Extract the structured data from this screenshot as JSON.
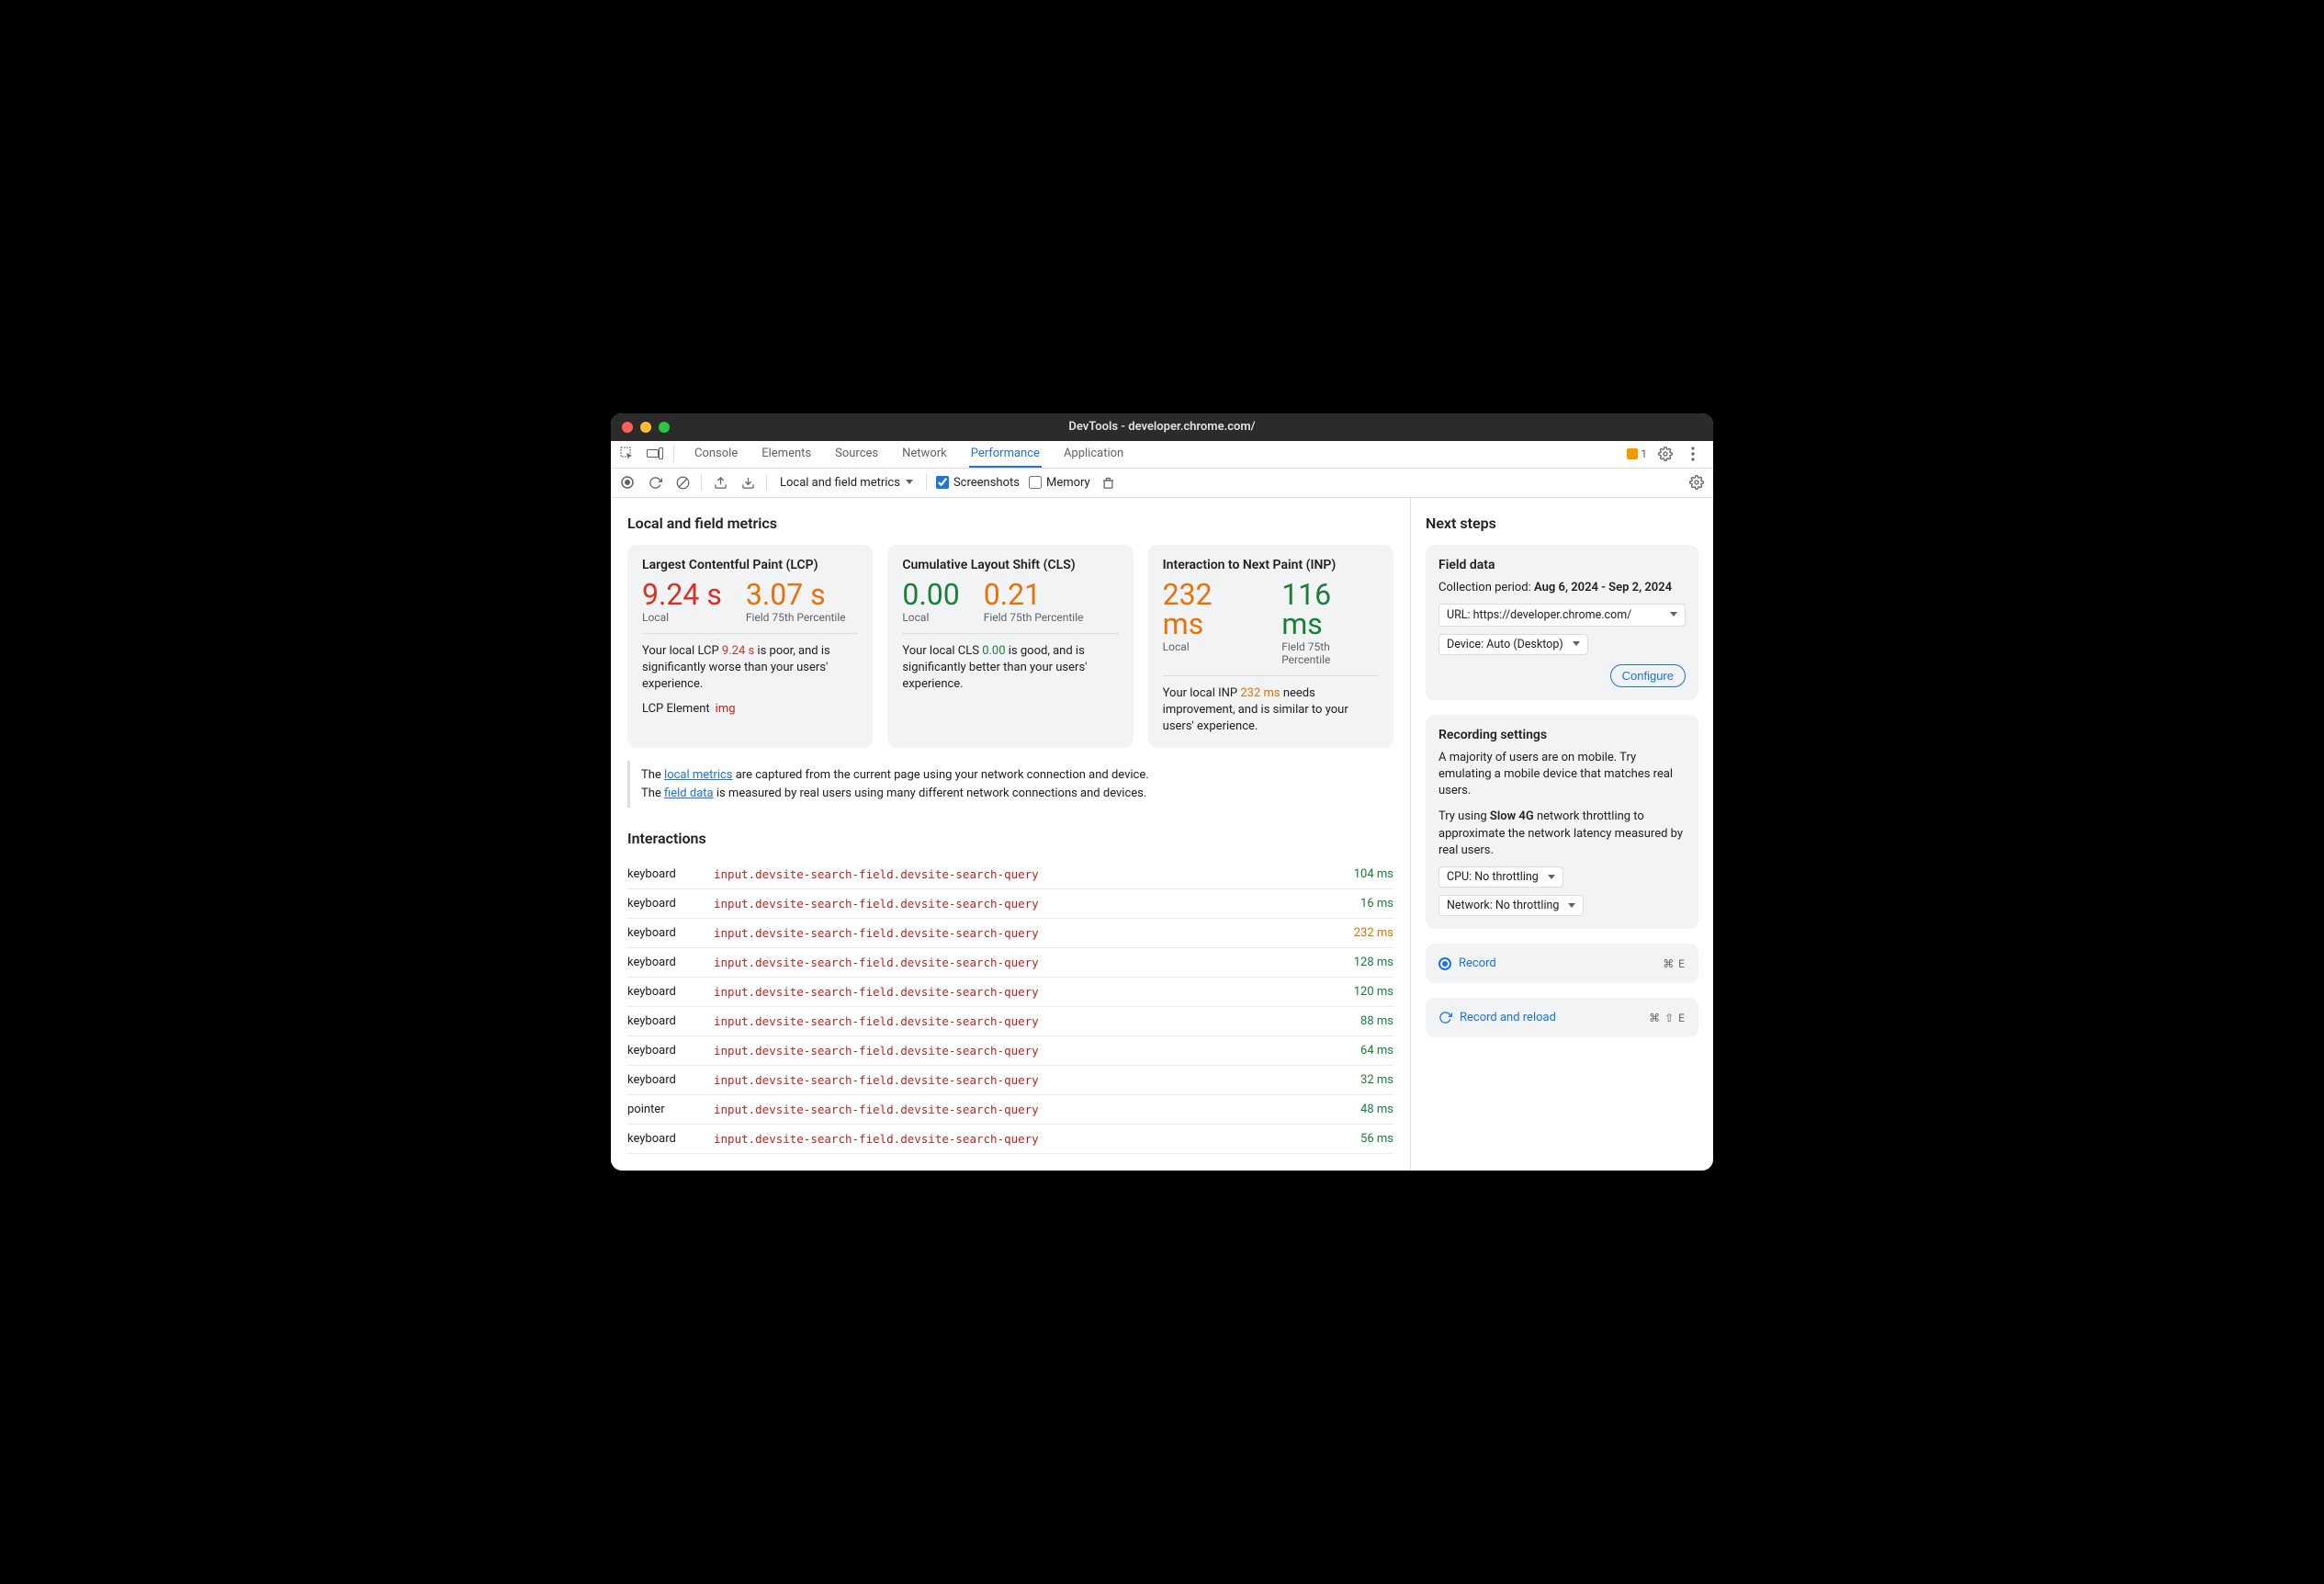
{
  "window": {
    "title": "DevTools - developer.chrome.com/"
  },
  "tabs": {
    "items": [
      "Console",
      "Elements",
      "Sources",
      "Network",
      "Performance",
      "Application"
    ],
    "active_index": 4
  },
  "issue_count": "1",
  "toolbar": {
    "mode_selector": "Local and field metrics",
    "screenshots_label": "Screenshots",
    "screenshots_checked": true,
    "memory_label": "Memory",
    "memory_checked": false
  },
  "left_heading": "Local and field metrics",
  "metrics": [
    {
      "title": "Largest Contentful Paint (LCP)",
      "local_value": "9.24 s",
      "local_class": "poor",
      "field_value": "3.07 s",
      "field_class": "warn",
      "local_label": "Local",
      "field_label": "Field 75th Percentile",
      "desc_pre": "Your local LCP ",
      "desc_val": "9.24 s",
      "desc_val_class": "poor",
      "desc_post": " is poor, and is significantly worse than your users' experience.",
      "extra_label": "LCP Element",
      "extra_tag": "img"
    },
    {
      "title": "Cumulative Layout Shift (CLS)",
      "local_value": "0.00",
      "local_class": "good",
      "field_value": "0.21",
      "field_class": "warn",
      "local_label": "Local",
      "field_label": "Field 75th Percentile",
      "desc_pre": "Your local CLS ",
      "desc_val": "0.00",
      "desc_val_class": "good",
      "desc_post": " is good, and is significantly better than your users' experience."
    },
    {
      "title": "Interaction to Next Paint (INP)",
      "local_value": "232 ms",
      "local_class": "warn",
      "field_value": "116 ms",
      "field_class": "good",
      "local_label": "Local",
      "field_label": "Field 75th Percentile",
      "desc_pre": "Your local INP ",
      "desc_val": "232 ms",
      "desc_val_class": "warn",
      "desc_post": " needs improvement, and is similar to your users' experience."
    }
  ],
  "info_box": {
    "line1_pre": "The ",
    "line1_link": "local metrics",
    "line1_post": " are captured from the current page using your network connection and device.",
    "line2_pre": "The ",
    "line2_link": "field data",
    "line2_post": " is measured by real users using many different network connections and devices."
  },
  "interactions_heading": "Interactions",
  "interactions": [
    {
      "type": "keyboard",
      "target": "input.devsite-search-field.devsite-search-query",
      "time": "104 ms",
      "cls": ""
    },
    {
      "type": "keyboard",
      "target": "input.devsite-search-field.devsite-search-query",
      "time": "16 ms",
      "cls": ""
    },
    {
      "type": "keyboard",
      "target": "input.devsite-search-field.devsite-search-query",
      "time": "232 ms",
      "cls": "warn"
    },
    {
      "type": "keyboard",
      "target": "input.devsite-search-field.devsite-search-query",
      "time": "128 ms",
      "cls": ""
    },
    {
      "type": "keyboard",
      "target": "input.devsite-search-field.devsite-search-query",
      "time": "120 ms",
      "cls": ""
    },
    {
      "type": "keyboard",
      "target": "input.devsite-search-field.devsite-search-query",
      "time": "88 ms",
      "cls": ""
    },
    {
      "type": "keyboard",
      "target": "input.devsite-search-field.devsite-search-query",
      "time": "64 ms",
      "cls": ""
    },
    {
      "type": "keyboard",
      "target": "input.devsite-search-field.devsite-search-query",
      "time": "32 ms",
      "cls": ""
    },
    {
      "type": "pointer",
      "target": "input.devsite-search-field.devsite-search-query",
      "time": "48 ms",
      "cls": ""
    },
    {
      "type": "keyboard",
      "target": "input.devsite-search-field.devsite-search-query",
      "time": "56 ms",
      "cls": ""
    }
  ],
  "next_steps_heading": "Next steps",
  "field_data": {
    "title": "Field data",
    "period_label": "Collection period:",
    "period_value": "Aug 6, 2024 - Sep 2, 2024",
    "url_label": "URL: https://developer.chrome.com/",
    "device_label": "Device: Auto (Desktop)",
    "configure_label": "Configure"
  },
  "recording_settings": {
    "title": "Recording settings",
    "p1": "A majority of users are on mobile. Try emulating a mobile device that matches real users.",
    "p2_pre": "Try using ",
    "p2_bold": "Slow 4G",
    "p2_post": " network throttling to approximate the network latency measured by real users.",
    "cpu_label": "CPU: No throttling",
    "net_label": "Network: No throttling"
  },
  "record_action": {
    "label": "Record",
    "shortcut": "⌘ E"
  },
  "record_reload_action": {
    "label": "Record and reload",
    "shortcut": "⌘ ⇧ E"
  }
}
